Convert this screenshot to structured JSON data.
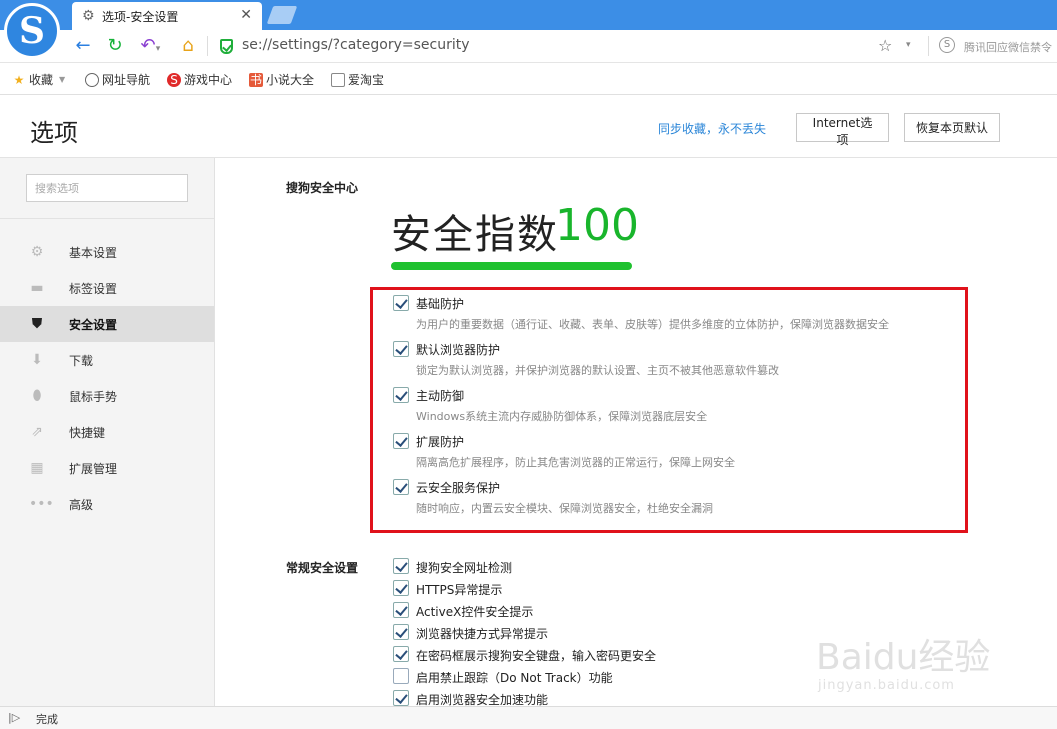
{
  "browser": {
    "tab_title": "选项-安全设置",
    "url": "se://settings/?category=security",
    "news_ticker": "腾讯回应微信禁令"
  },
  "bookmarks": [
    {
      "label": "收藏",
      "icon": "star-icon"
    },
    {
      "label": "网址导航",
      "icon": "globe-icon"
    },
    {
      "label": "游戏中心",
      "icon": "game-icon"
    },
    {
      "label": "小说大全",
      "icon": "novel-icon"
    },
    {
      "label": "爱淘宝",
      "icon": "page-icon"
    }
  ],
  "header": {
    "title": "选项",
    "sync_link": "同步收藏，永不丢失",
    "internet_options": "Internet选项",
    "restore_defaults": "恢复本页默认"
  },
  "sidebar": {
    "search_placeholder": "搜索选项",
    "items": [
      {
        "label": "基本设置",
        "icon": "gear-icon",
        "active": false
      },
      {
        "label": "标签设置",
        "icon": "tab-icon",
        "active": false
      },
      {
        "label": "安全设置",
        "icon": "shield-icon",
        "active": true
      },
      {
        "label": "下载",
        "icon": "download-icon",
        "active": false
      },
      {
        "label": "鼠标手势",
        "icon": "mouse-icon",
        "active": false
      },
      {
        "label": "快捷键",
        "icon": "shortcut-icon",
        "active": false
      },
      {
        "label": "扩展管理",
        "icon": "extension-icon",
        "active": false
      },
      {
        "label": "高级",
        "icon": "more-icon",
        "active": false
      }
    ]
  },
  "security_center": {
    "section_label": "搜狗安全中心",
    "score_label": "安全指数",
    "score_value": "100",
    "protections": [
      {
        "label": "基础防护",
        "desc": "为用户的重要数据（通行证、收藏、表单、皮肤等）提供多维度的立体防护，保障浏览器数据安全",
        "checked": true
      },
      {
        "label": "默认浏览器防护",
        "desc": "锁定为默认浏览器，并保护浏览器的默认设置、主页不被其他恶意软件篡改",
        "checked": true
      },
      {
        "label": "主动防御",
        "desc": "Windows系统主流内存威胁防御体系，保障浏览器底层安全",
        "checked": true
      },
      {
        "label": "扩展防护",
        "desc": "隔离高危扩展程序，防止其危害浏览器的正常运行，保障上网安全",
        "checked": true
      },
      {
        "label": "云安全服务保护",
        "desc": "随时响应，内置云安全模块、保障浏览器安全，杜绝安全漏洞",
        "checked": true
      }
    ]
  },
  "general_security": {
    "section_label": "常规安全设置",
    "options": [
      {
        "label": "搜狗安全网址检测",
        "checked": true
      },
      {
        "label": "HTTPS异常提示",
        "checked": true
      },
      {
        "label": "ActiveX控件安全提示",
        "checked": true
      },
      {
        "label": "浏览器快捷方式异常提示",
        "checked": true
      },
      {
        "label": "在密码框展示搜狗安全键盘，输入密码更安全",
        "checked": true
      },
      {
        "label": "启用禁止跟踪（Do Not Track）功能",
        "checked": false
      },
      {
        "label": "启用浏览器安全加速功能",
        "checked": true
      }
    ]
  },
  "status": {
    "text": "完成"
  },
  "watermark": {
    "logo": "Baidu经验",
    "url": "jingyan.baidu.com"
  },
  "colors": {
    "accent": "#3c8ee6",
    "score_green": "#19b52c",
    "highlight_red": "#e0121b",
    "link_blue": "#2b86d8"
  }
}
